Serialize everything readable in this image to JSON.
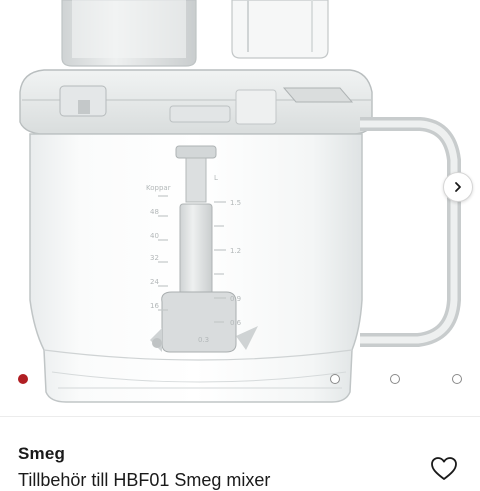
{
  "product": {
    "brand": "Smeg",
    "title": "Tillbehör till HBF01 Smeg mixer"
  },
  "gallery": {
    "dot_count": 4,
    "active_index": 0,
    "accent_color": "#b01e23",
    "next_icon": "chevron-right-icon",
    "jug_scale_left": [
      "Koppar",
      "48",
      "40",
      "32",
      "24",
      "16"
    ],
    "jug_scale_right": [
      "L",
      "1.5",
      "1.2",
      "0.9",
      "0.6",
      "0.3"
    ]
  },
  "actions": {
    "wishlist_icon": "heart-icon"
  }
}
